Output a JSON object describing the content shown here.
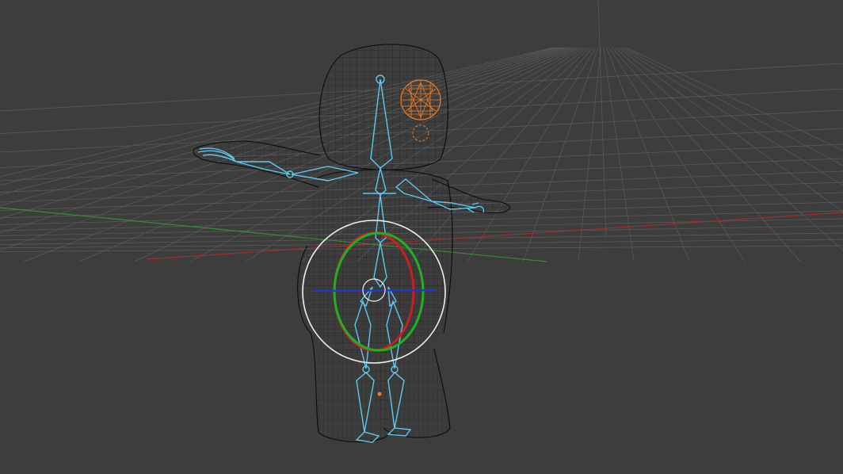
{
  "viewport": {
    "background": "#3d3d3d",
    "grid_color": "#5c5c5c",
    "x_axis_color": "#9c3030",
    "y_axis_color": "#3a8a3a"
  },
  "mesh": {
    "wire_color": "#111111"
  },
  "armature": {
    "bone_color": "#5ec8f0"
  },
  "selected_object": {
    "color": "#f07d22"
  },
  "rotate_gizmo": {
    "outer_color": "#f0f0f0",
    "x_ring_color": "#c82020",
    "y_ring_color": "#20b020",
    "z_ring_color": "#2035d8"
  }
}
